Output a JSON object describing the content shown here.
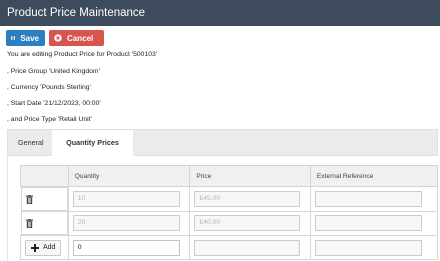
{
  "window": {
    "title": "Product Price Maintenance"
  },
  "toolbar": {
    "save_label": "Save",
    "cancel_label": "Cancel",
    "save_icon": "floppy-disk-icon",
    "cancel_icon": "times-circle-icon"
  },
  "info": {
    "line1": "You are editing Product Price for Product '500103'",
    "line2": ", Price Group 'United Kingdom'",
    "line3": ", Currency 'Pounds Sterling'",
    "line4": ", Start Date '21/12/2023, 00:00'",
    "line5": ", and Price Type 'Retail Unit'"
  },
  "tabs": [
    {
      "label": "General",
      "active": false
    },
    {
      "label": "Quantity Prices",
      "active": true
    }
  ],
  "table": {
    "headers": [
      "",
      "Quantity",
      "Price",
      "External Reference"
    ],
    "rows": [
      {
        "quantity": "10",
        "price": "£45.00",
        "external_reference": ""
      },
      {
        "quantity": "20",
        "price": "£40.00",
        "external_reference": ""
      }
    ],
    "new_row": {
      "add_label": "Add",
      "quantity": "0",
      "price": "",
      "external_reference": ""
    }
  },
  "colors": {
    "titlebar": "#3d4b5d",
    "save": "#2b7fc3",
    "cancel": "#d9534f"
  }
}
